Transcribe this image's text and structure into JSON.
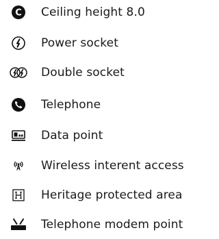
{
  "legend": {
    "items": [
      {
        "icon": "ceiling-height-icon",
        "label": "Ceiling height  8.0"
      },
      {
        "icon": "power-socket-icon",
        "label": "Power socket"
      },
      {
        "icon": "double-socket-icon",
        "label": "Double socket"
      },
      {
        "icon": "telephone-icon",
        "label": "Telephone"
      },
      {
        "icon": "data-point-icon",
        "label": "Data point"
      },
      {
        "icon": "wireless-icon",
        "label": "Wireless interent access"
      },
      {
        "icon": "heritage-icon",
        "label": "Heritage protected area"
      },
      {
        "icon": "modem-point-icon",
        "label": "Telephone modem point"
      }
    ]
  },
  "colors": {
    "text": "#1a1a1a",
    "icon": "#111111"
  }
}
